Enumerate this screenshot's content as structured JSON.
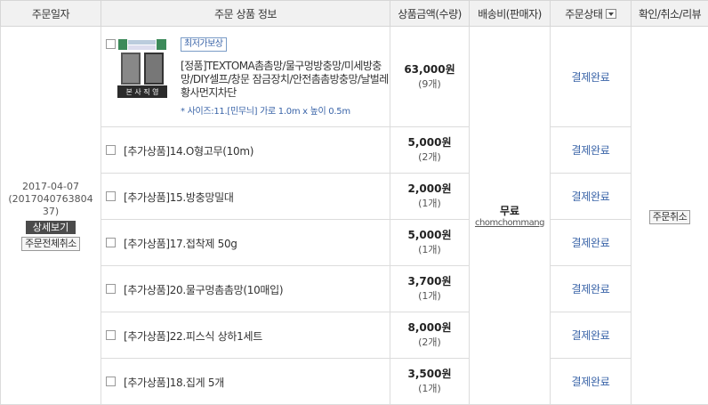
{
  "headers": {
    "date": "주문일자",
    "product": "주문 상품 정보",
    "price": "상품금액(수량)",
    "shipping": "배송비(판매자)",
    "status": "주문상태",
    "action": "확인/취소/리뷰"
  },
  "order": {
    "date": "2017-04-07",
    "number": "(2017040763804​37)",
    "detail_button": "상세보기",
    "cancel_all_button": "주문전체취소"
  },
  "main_item": {
    "badge": "최저가보상",
    "thumb_top_text": "촘촘하고 시원한 방충망",
    "thumb_bottom_text": "본 사 직 영",
    "name": "[정품]TEXTOMA촘촘망/물구멍방충망/미세방충망/DIY셀프/창문 잠금장치/안전촘촘방충망/날벌레 황사먼지차단",
    "option": "* 사이즈:11.[민무늬] 가로 1.0m x 높이 0.5m",
    "price": "63,000원",
    "qty": "(9개)",
    "status": "결제완료"
  },
  "add_items": [
    {
      "name": "[추가상품]14.O형고무(10m)",
      "price": "5,000원",
      "qty": "(2개)",
      "status": "결제완료"
    },
    {
      "name": "[추가상품]15.방충망밀대",
      "price": "2,000원",
      "qty": "(1개)",
      "status": "결제완료"
    },
    {
      "name": "[추가상품]17.접착제 50g",
      "price": "5,000원",
      "qty": "(1개)",
      "status": "결제완료"
    },
    {
      "name": "[추가상품]20.물구멍촘촘망(10매입)",
      "price": "3,700원",
      "qty": "(1개)",
      "status": "결제완료"
    },
    {
      "name": "[추가상품]22.피스식 상하1세트",
      "price": "8,000원",
      "qty": "(2개)",
      "status": "결제완료"
    },
    {
      "name": "[추가상품]18.집게 5개",
      "price": "3,500원",
      "qty": "(1개)",
      "status": "결제완료"
    }
  ],
  "shipping": {
    "fee": "무료",
    "seller": "chomchommang"
  },
  "action": {
    "cancel_button": "주문취소"
  },
  "colors": {
    "header_bg": "#f1f1f1",
    "link_blue": "#3a64a8",
    "dark_button": "#4b4b4b"
  }
}
